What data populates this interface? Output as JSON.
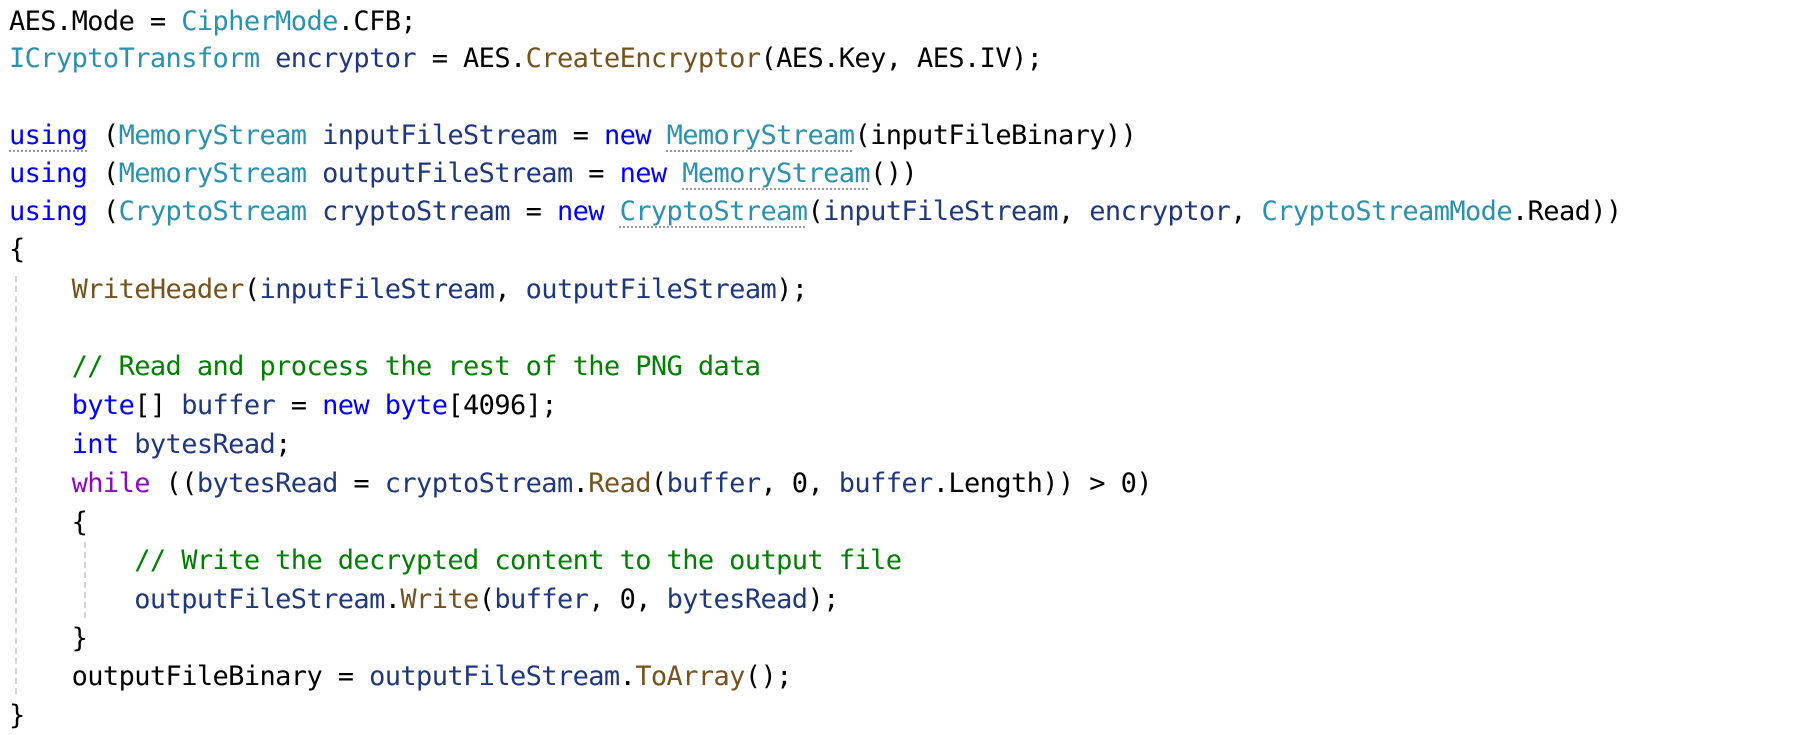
{
  "colors": {
    "plain": "#000000",
    "type": "#2b91af",
    "keyword": "#0000ff",
    "control": "#8f08c4",
    "method": "#74531f",
    "identifier": "#1f377f",
    "comment": "#008000",
    "number": "#098658"
  },
  "code": {
    "lines": [
      [
        {
          "t": "AES",
          "k": "plain"
        },
        {
          "t": ".Mode = ",
          "k": "plain"
        },
        {
          "t": "CipherMode",
          "k": "type"
        },
        {
          "t": ".CFB;",
          "k": "plain"
        }
      ],
      [
        {
          "t": "ICryptoTransform",
          "k": "type"
        },
        {
          "t": " ",
          "k": "plain"
        },
        {
          "t": "encryptor",
          "k": "identifier"
        },
        {
          "t": " = AES.",
          "k": "plain"
        },
        {
          "t": "CreateEncryptor",
          "k": "method"
        },
        {
          "t": "(AES.Key, AES.IV);",
          "k": "plain"
        }
      ],
      [],
      [
        {
          "t": "using",
          "k": "keyword",
          "squiggle": true
        },
        {
          "t": " (",
          "k": "plain"
        },
        {
          "t": "MemoryStream",
          "k": "type"
        },
        {
          "t": " ",
          "k": "plain"
        },
        {
          "t": "inputFileStream",
          "k": "identifier"
        },
        {
          "t": " = ",
          "k": "plain"
        },
        {
          "t": "new",
          "k": "keyword"
        },
        {
          "t": " ",
          "k": "plain"
        },
        {
          "t": "MemoryStream",
          "k": "type",
          "squiggle": true
        },
        {
          "t": "(inputFileBinary))",
          "k": "plain"
        }
      ],
      [
        {
          "t": "using",
          "k": "keyword"
        },
        {
          "t": " (",
          "k": "plain"
        },
        {
          "t": "MemoryStream",
          "k": "type"
        },
        {
          "t": " ",
          "k": "plain"
        },
        {
          "t": "outputFileStream",
          "k": "identifier"
        },
        {
          "t": " = ",
          "k": "plain"
        },
        {
          "t": "new",
          "k": "keyword"
        },
        {
          "t": " ",
          "k": "plain"
        },
        {
          "t": "MemoryStream",
          "k": "type",
          "squiggle": true
        },
        {
          "t": "())",
          "k": "plain"
        }
      ],
      [
        {
          "t": "using",
          "k": "keyword"
        },
        {
          "t": " (",
          "k": "plain"
        },
        {
          "t": "CryptoStream",
          "k": "type"
        },
        {
          "t": " ",
          "k": "plain"
        },
        {
          "t": "cryptoStream",
          "k": "identifier"
        },
        {
          "t": " = ",
          "k": "plain"
        },
        {
          "t": "new",
          "k": "keyword"
        },
        {
          "t": " ",
          "k": "plain"
        },
        {
          "t": "CryptoStream",
          "k": "type",
          "squiggle": true
        },
        {
          "t": "(",
          "k": "plain"
        },
        {
          "t": "inputFileStream",
          "k": "identifier"
        },
        {
          "t": ", ",
          "k": "plain"
        },
        {
          "t": "encryptor",
          "k": "identifier"
        },
        {
          "t": ", ",
          "k": "plain"
        },
        {
          "t": "CryptoStreamMode",
          "k": "type"
        },
        {
          "t": ".Read))",
          "k": "plain"
        }
      ],
      [
        {
          "t": "{",
          "k": "plain"
        }
      ],
      [
        {
          "t": "    ",
          "k": "plain"
        },
        {
          "t": "WriteHeader",
          "k": "method"
        },
        {
          "t": "(",
          "k": "plain"
        },
        {
          "t": "inputFileStream",
          "k": "identifier"
        },
        {
          "t": ", ",
          "k": "plain"
        },
        {
          "t": "outputFileStream",
          "k": "identifier"
        },
        {
          "t": ");",
          "k": "plain"
        }
      ],
      [],
      [
        {
          "t": "    ",
          "k": "plain"
        },
        {
          "t": "// Read and process the rest of the PNG data",
          "k": "comment"
        }
      ],
      [
        {
          "t": "    ",
          "k": "plain"
        },
        {
          "t": "byte",
          "k": "keyword"
        },
        {
          "t": "[] ",
          "k": "plain"
        },
        {
          "t": "buffer",
          "k": "identifier"
        },
        {
          "t": " = ",
          "k": "plain"
        },
        {
          "t": "new",
          "k": "keyword"
        },
        {
          "t": " ",
          "k": "plain"
        },
        {
          "t": "byte",
          "k": "keyword"
        },
        {
          "t": "[",
          "k": "plain"
        },
        {
          "t": "4096",
          "k": "plain"
        },
        {
          "t": "];",
          "k": "plain"
        }
      ],
      [
        {
          "t": "    ",
          "k": "plain"
        },
        {
          "t": "int",
          "k": "keyword"
        },
        {
          "t": " ",
          "k": "plain"
        },
        {
          "t": "bytesRead",
          "k": "identifier"
        },
        {
          "t": ";",
          "k": "plain"
        }
      ],
      [
        {
          "t": "    ",
          "k": "plain"
        },
        {
          "t": "while",
          "k": "control"
        },
        {
          "t": " ((",
          "k": "plain"
        },
        {
          "t": "bytesRead",
          "k": "identifier"
        },
        {
          "t": " = ",
          "k": "plain"
        },
        {
          "t": "cryptoStream",
          "k": "identifier"
        },
        {
          "t": ".",
          "k": "plain"
        },
        {
          "t": "Read",
          "k": "method"
        },
        {
          "t": "(",
          "k": "plain"
        },
        {
          "t": "buffer",
          "k": "identifier"
        },
        {
          "t": ", 0, ",
          "k": "plain"
        },
        {
          "t": "buffer",
          "k": "identifier"
        },
        {
          "t": ".Length)) > 0)",
          "k": "plain"
        }
      ],
      [
        {
          "t": "    {",
          "k": "plain"
        }
      ],
      [
        {
          "t": "        ",
          "k": "plain"
        },
        {
          "t": "// Write the decrypted content to the output file",
          "k": "comment"
        }
      ],
      [
        {
          "t": "        ",
          "k": "plain"
        },
        {
          "t": "outputFileStream",
          "k": "identifier"
        },
        {
          "t": ".",
          "k": "plain"
        },
        {
          "t": "Write",
          "k": "method"
        },
        {
          "t": "(",
          "k": "plain"
        },
        {
          "t": "buffer",
          "k": "identifier"
        },
        {
          "t": ", 0, ",
          "k": "plain"
        },
        {
          "t": "bytesRead",
          "k": "identifier"
        },
        {
          "t": ");",
          "k": "plain"
        }
      ],
      [
        {
          "t": "    }",
          "k": "plain"
        }
      ],
      [
        {
          "t": "    outputFileBinary = ",
          "k": "plain"
        },
        {
          "t": "outputFileStream",
          "k": "identifier"
        },
        {
          "t": ".",
          "k": "plain"
        },
        {
          "t": "ToArray",
          "k": "method"
        },
        {
          "t": "();",
          "k": "plain"
        }
      ],
      [
        {
          "t": "}",
          "k": "plain"
        }
      ]
    ]
  }
}
